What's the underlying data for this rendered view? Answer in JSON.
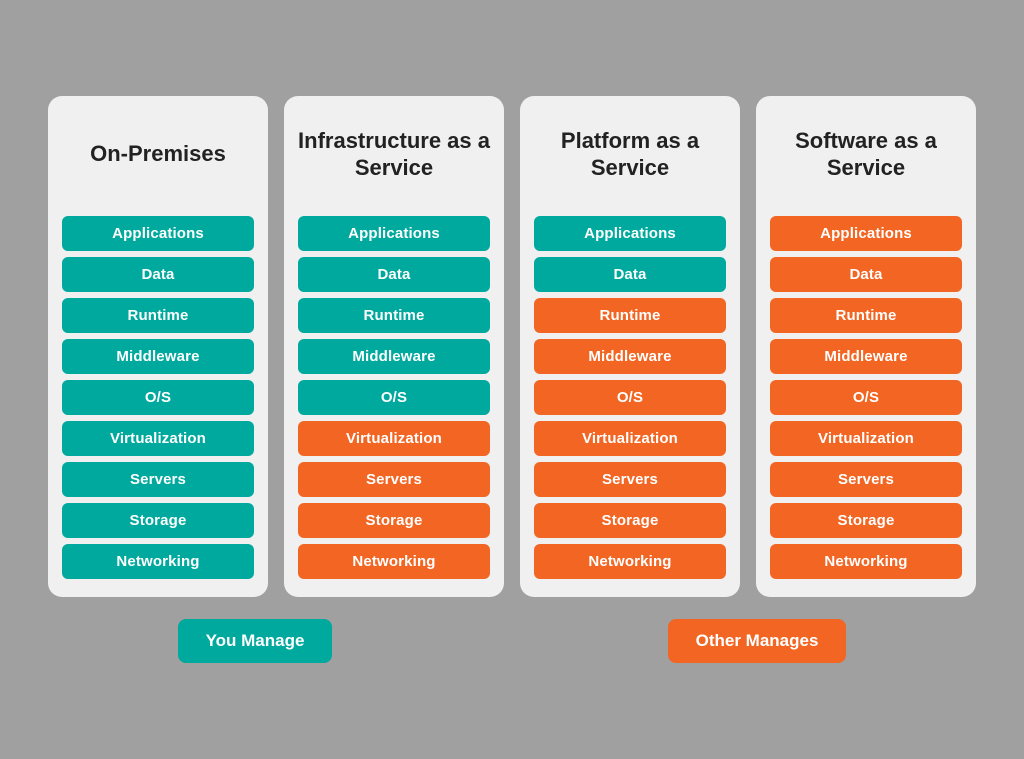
{
  "columns": [
    {
      "id": "on-premises",
      "title": "On-Premises",
      "items": [
        {
          "label": "Applications",
          "color": "teal"
        },
        {
          "label": "Data",
          "color": "teal"
        },
        {
          "label": "Runtime",
          "color": "teal"
        },
        {
          "label": "Middleware",
          "color": "teal"
        },
        {
          "label": "O/S",
          "color": "teal"
        },
        {
          "label": "Virtualization",
          "color": "teal"
        },
        {
          "label": "Servers",
          "color": "teal"
        },
        {
          "label": "Storage",
          "color": "teal"
        },
        {
          "label": "Networking",
          "color": "teal"
        }
      ]
    },
    {
      "id": "iaas",
      "title": "Infrastructure as a Service",
      "items": [
        {
          "label": "Applications",
          "color": "teal"
        },
        {
          "label": "Data",
          "color": "teal"
        },
        {
          "label": "Runtime",
          "color": "teal"
        },
        {
          "label": "Middleware",
          "color": "teal"
        },
        {
          "label": "O/S",
          "color": "teal"
        },
        {
          "label": "Virtualization",
          "color": "orange"
        },
        {
          "label": "Servers",
          "color": "orange"
        },
        {
          "label": "Storage",
          "color": "orange"
        },
        {
          "label": "Networking",
          "color": "orange"
        }
      ]
    },
    {
      "id": "paas",
      "title": "Platform as a Service",
      "items": [
        {
          "label": "Applications",
          "color": "teal"
        },
        {
          "label": "Data",
          "color": "teal"
        },
        {
          "label": "Runtime",
          "color": "orange"
        },
        {
          "label": "Middleware",
          "color": "orange"
        },
        {
          "label": "O/S",
          "color": "orange"
        },
        {
          "label": "Virtualization",
          "color": "orange"
        },
        {
          "label": "Servers",
          "color": "orange"
        },
        {
          "label": "Storage",
          "color": "orange"
        },
        {
          "label": "Networking",
          "color": "orange"
        }
      ]
    },
    {
      "id": "saas",
      "title": "Software as a Service",
      "items": [
        {
          "label": "Applications",
          "color": "orange"
        },
        {
          "label": "Data",
          "color": "orange"
        },
        {
          "label": "Runtime",
          "color": "orange"
        },
        {
          "label": "Middleware",
          "color": "orange"
        },
        {
          "label": "O/S",
          "color": "orange"
        },
        {
          "label": "Virtualization",
          "color": "orange"
        },
        {
          "label": "Servers",
          "color": "orange"
        },
        {
          "label": "Storage",
          "color": "orange"
        },
        {
          "label": "Networking",
          "color": "orange"
        }
      ]
    }
  ],
  "legend": {
    "you_manage": "You Manage",
    "other_manages": "Other Manages"
  }
}
